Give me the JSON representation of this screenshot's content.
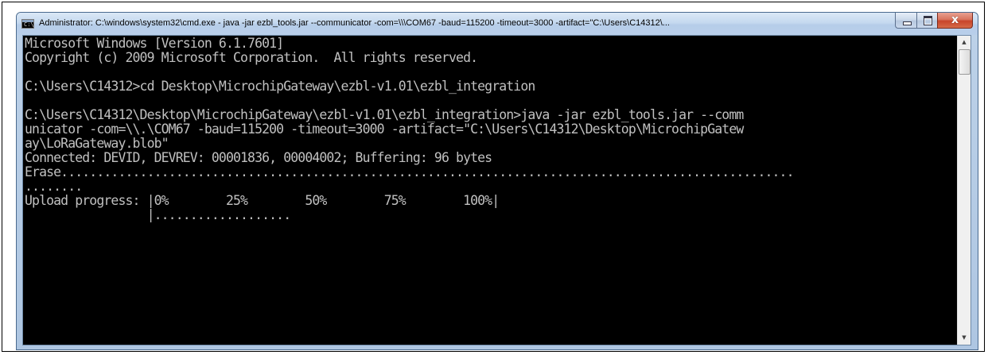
{
  "window": {
    "title": "Administrator: C:\\windows\\system32\\cmd.exe - java  -jar ezbl_tools.jar --communicator -com=\\\\\\COM67 -baud=115200 -timeout=3000 -artifact=\"C:\\Users\\C14312\\...",
    "app_icon": "cmd-icon",
    "controls": {
      "minimize_icon": "minimize-icon",
      "maximize_icon": "maximize-icon",
      "close_icon": "close-icon",
      "close_glyph": "x"
    }
  },
  "console": {
    "lines": [
      "Microsoft Windows [Version 6.1.7601]",
      "Copyright (c) 2009 Microsoft Corporation.  All rights reserved.",
      "",
      "C:\\Users\\C14312>cd Desktop\\MicrochipGateway\\ezbl-v1.01\\ezbl_integration",
      "",
      "C:\\Users\\C14312\\Desktop\\MicrochipGateway\\ezbl-v1.01\\ezbl_integration>java -jar ezbl_tools.jar --comm",
      "unicator -com=\\\\.\\COM67 -baud=115200 -timeout=3000 -artifact=\"C:\\Users\\C14312\\Desktop\\MicrochipGatew",
      "ay\\LoRaGateway.blob\"",
      "Connected: DEVID, DEVREV: 00001836, 00004002; Buffering: 96 bytes",
      "Erase......................................................................................................",
      "........",
      "Upload progress: |0%        25%        50%        75%        100%|",
      "                 |...................",
      "",
      "",
      "",
      "",
      "",
      "",
      "",
      ""
    ]
  },
  "scrollbar": {
    "up_arrow": "▲",
    "down_arrow": "▼",
    "position_fraction": 0.0
  },
  "colors": {
    "console_background": "#000000",
    "console_text": "#c0c0c0",
    "titlebar": "#c5d9ef",
    "close_button": "#c8442a"
  }
}
